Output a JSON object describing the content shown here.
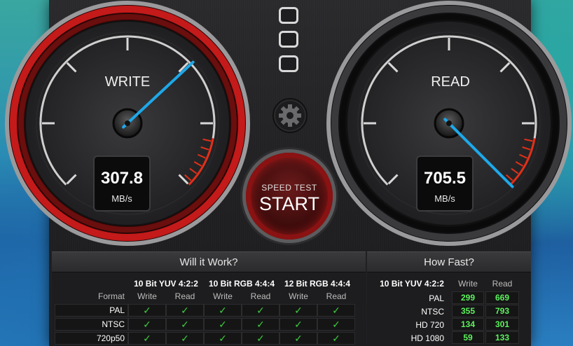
{
  "window_controls": [
    {
      "name": "close"
    },
    {
      "name": "minimize"
    },
    {
      "name": "zoom"
    }
  ],
  "write_gauge": {
    "label": "WRITE",
    "value": "307.8",
    "unit": "MB/s"
  },
  "read_gauge": {
    "label": "READ",
    "value": "705.5",
    "unit": "MB/s"
  },
  "start_button": {
    "caption": "SPEED TEST",
    "label": "START"
  },
  "settings": {
    "icon": "gear-icon"
  },
  "will_it_work": {
    "title": "Will it Work?",
    "format_label": "Format",
    "groups": [
      "10 Bit YUV 4:2:2",
      "10 Bit RGB 4:4:4",
      "12 Bit RGB 4:4:4"
    ],
    "write_label": "Write",
    "read_label": "Read",
    "rows": [
      {
        "format": "PAL",
        "checks": [
          "✓",
          "✓",
          "✓",
          "✓",
          "✓",
          "✓"
        ]
      },
      {
        "format": "NTSC",
        "checks": [
          "✓",
          "✓",
          "✓",
          "✓",
          "✓",
          "✓"
        ]
      },
      {
        "format": "720p50",
        "checks": [
          "✓",
          "✓",
          "✓",
          "✓",
          "✓",
          "✓"
        ]
      }
    ]
  },
  "how_fast": {
    "title": "How Fast?",
    "group": "10 Bit YUV 4:2:2",
    "write_label": "Write",
    "read_label": "Read",
    "rows": [
      {
        "format": "PAL",
        "write": "299",
        "read": "669"
      },
      {
        "format": "NTSC",
        "write": "355",
        "read": "793"
      },
      {
        "format": "HD 720",
        "write": "134",
        "read": "301"
      },
      {
        "format": "HD 1080",
        "write": "59",
        "read": "133"
      }
    ]
  },
  "colors": {
    "needle": "#1ea8e8",
    "accent_red": "#c41a1a",
    "check_green": "#3ecf3e",
    "number_green": "#5cf25c"
  }
}
